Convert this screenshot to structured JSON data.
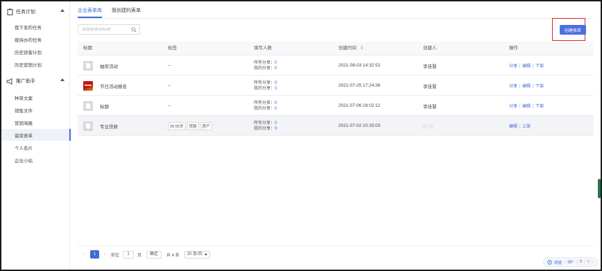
{
  "sidebar": {
    "groups": [
      {
        "label": "任务计划",
        "icon": "clipboard-icon",
        "items": [
          "我下发的任务",
          "我待办的任务",
          "历史获客计划",
          "历史营销计划"
        ]
      },
      {
        "label": "推广助手",
        "icon": "megaphone-icon",
        "items": [
          "种草文案",
          "销售文件",
          "营销海报",
          "留资表单",
          "个人名片",
          "企业小站"
        ]
      }
    ],
    "active_item": "留资表单"
  },
  "tabs": [
    "企业表单库",
    "我创建的表单"
  ],
  "active_tab": "企业表单库",
  "search": {
    "placeholder": "请搜索表单标题",
    "value": ""
  },
  "create_button": "创建表单",
  "table": {
    "columns": [
      "标题",
      "标签",
      "填写人数",
      "创建时间",
      "创建人",
      "操作"
    ],
    "sort_indicator": "⇕",
    "fill_labels": {
      "all": "所有分享：",
      "mine": "我的分享："
    },
    "rows": [
      {
        "thumb": "doc",
        "title": "抽奖活动",
        "tag": "--",
        "all_share": "0",
        "my_share": "0",
        "created": "2021-08-03 14:32:52",
        "creator": "李佳慧",
        "ops": [
          "分享",
          "编辑",
          "下架"
        ]
      },
      {
        "thumb": "image",
        "title": "节日活动报名",
        "tag": "--",
        "all_share": "0",
        "my_share": "0",
        "created": "2021-07-25 17:24:36",
        "creator": "李佳慧",
        "ops": [
          "分享",
          "编辑",
          "下架"
        ]
      },
      {
        "thumb": "doc",
        "title": "标题",
        "tag": "--",
        "all_share": "0",
        "my_share": "0",
        "created": "2021-07-06 18:02:12",
        "creator": "李佳慧",
        "ops": [
          "分享",
          "编辑",
          "下架"
        ]
      },
      {
        "thumb": "doc",
        "title": "专业贷款",
        "tags": [
          "25-55岁",
          "贷款",
          "房产"
        ],
        "all_share": "0",
        "my_share": "0",
        "created": "2021-07-02 10:25:03",
        "creator": "",
        "ops": [
          "编辑",
          "上架"
        ]
      }
    ]
  },
  "pagination": {
    "prev": "‹",
    "current": "1",
    "next": "›",
    "goto_label": "前往",
    "goto_value": "1",
    "page_unit": "页",
    "confirm": "确定",
    "total": "共 4 条",
    "page_size": "20 条/页"
  },
  "widget": {
    "label": "消息",
    "count_blue": "99⁺",
    "count_orange": "0",
    "count_red": "0"
  },
  "watermark_text": "李佳慧 4763",
  "colors": {
    "accent": "#3d6bd9",
    "highlight_border": "#e0251c",
    "button": "#4a6fe0"
  }
}
